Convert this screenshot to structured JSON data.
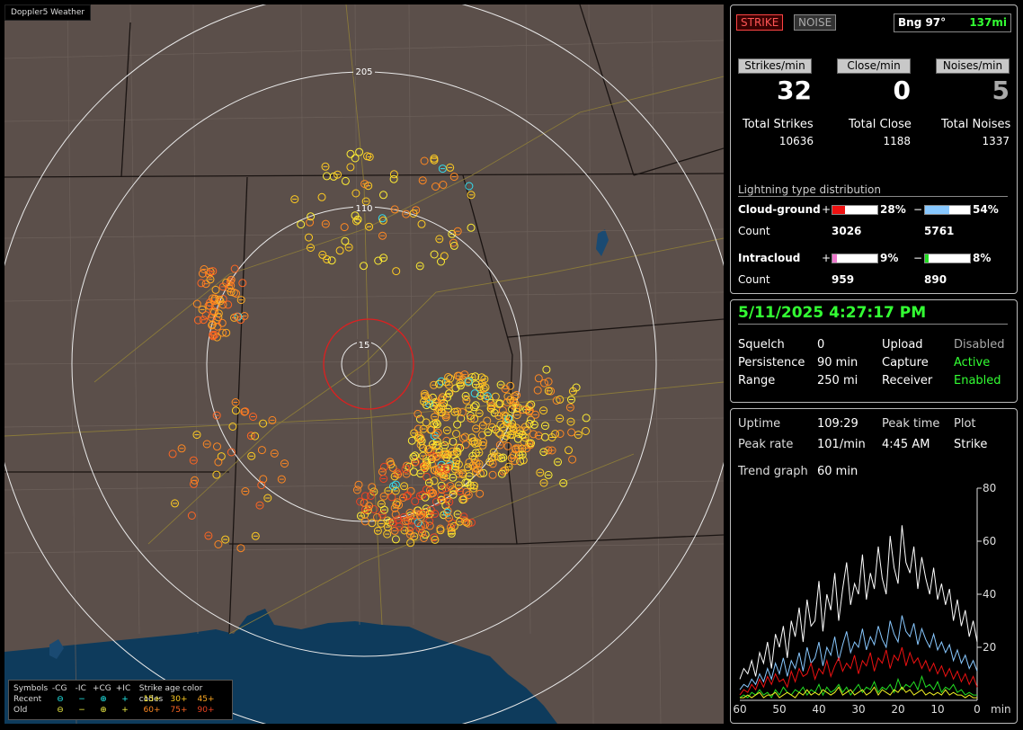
{
  "map": {
    "title": "Doppler5 Weather",
    "range_labels": [
      "205",
      "110",
      "15"
    ]
  },
  "legend": {
    "symbols_label": "Symbols",
    "cols": [
      "-CG",
      "-IC",
      "+CG",
      "+IC"
    ],
    "recent_label": "Recent",
    "old_label": "Old",
    "dash": "−",
    "plus": "+",
    "age_title": "Strike age color codes",
    "recent_ages": [
      "15+",
      "30+",
      "45+"
    ],
    "old_ages": [
      "60+",
      "75+",
      "90+"
    ]
  },
  "top": {
    "strike_btn": "STRIKE",
    "noise_btn": "NOISE",
    "bearing": "Bng 97°",
    "distance": "137mi"
  },
  "rates": {
    "strikes_label": "Strikes/min",
    "close_label": "Close/min",
    "noises_label": "Noises/min",
    "strikes_value": "32",
    "close_value": "0",
    "noises_value": "5"
  },
  "totals": {
    "strikes_label": "Total Strikes",
    "close_label": "Total Close",
    "noises_label": "Total Noises",
    "strikes_value": "10636",
    "close_value": "1188",
    "noises_value": "1337"
  },
  "distribution": {
    "title": "Lightning type distribution",
    "cg_label": "Cloud-ground",
    "ic_label": "Intracloud",
    "count_label": "Count",
    "plus": "+",
    "minus": "−",
    "cg_pos_pct": "28%",
    "cg_neg_pct": "54%",
    "ic_pos_pct": "9%",
    "ic_neg_pct": "8%",
    "cg_pos_frac": 0.28,
    "cg_neg_frac": 0.54,
    "ic_pos_frac": 0.09,
    "ic_neg_frac": 0.08,
    "cg_pos_count": "3026",
    "cg_neg_count": "5761",
    "ic_pos_count": "959",
    "ic_neg_count": "890",
    "colors": {
      "cg_pos": "#ee1111",
      "cg_neg": "#88c8ff",
      "ic_pos": "#ee77cc",
      "ic_neg": "#22dd22"
    }
  },
  "status": {
    "datetime": "5/11/2025 4:27:17 PM",
    "squelch_label": "Squelch",
    "squelch_value": "0",
    "persistence_label": "Persistence",
    "persistence_value": "90 min",
    "range_label": "Range",
    "range_value": "250 mi",
    "upload_label": "Upload",
    "upload_value": "Disabled",
    "capture_label": "Capture",
    "capture_value": "Active",
    "receiver_label": "Receiver",
    "receiver_value": "Enabled"
  },
  "stats": {
    "uptime_label": "Uptime",
    "uptime_value": "109:29",
    "peak_time_label": "Peak time",
    "peak_time_value": "4:45 AM",
    "plot_label": "Plot",
    "plot_value": "Strike",
    "peak_rate_label": "Peak rate",
    "peak_rate_value": "101/min",
    "trend_label": "Trend graph",
    "trend_value": "60 min"
  },
  "chart_data": {
    "type": "line",
    "xlabel": "min",
    "x_ticks": [
      "60",
      "50",
      "40",
      "30",
      "20",
      "10",
      "0"
    ],
    "y_ticks": [
      "80",
      "60",
      "40",
      "20"
    ],
    "xlim": [
      60,
      0
    ],
    "ylim": [
      0,
      80
    ],
    "series": [
      {
        "color": "#ffffff",
        "values": [
          8,
          12,
          10,
          15,
          9,
          18,
          14,
          22,
          12,
          25,
          20,
          28,
          16,
          30,
          24,
          35,
          22,
          38,
          28,
          30,
          45,
          26,
          40,
          34,
          48,
          30,
          42,
          52,
          36,
          44,
          40,
          55,
          38,
          48,
          42,
          58,
          46,
          40,
          62,
          50,
          44,
          66,
          52,
          48,
          58,
          42,
          54,
          46,
          40,
          50,
          38,
          44,
          36,
          42,
          30,
          38,
          28,
          34,
          24,
          30,
          22
        ]
      },
      {
        "color": "#88c8ff",
        "values": [
          4,
          6,
          5,
          8,
          6,
          10,
          7,
          12,
          8,
          14,
          10,
          16,
          9,
          15,
          12,
          18,
          11,
          20,
          14,
          16,
          22,
          13,
          20,
          17,
          24,
          15,
          21,
          26,
          18,
          22,
          20,
          27,
          19,
          24,
          21,
          28,
          23,
          20,
          30,
          25,
          22,
          32,
          26,
          24,
          29,
          21,
          27,
          23,
          20,
          25,
          19,
          22,
          18,
          21,
          15,
          19,
          14,
          17,
          12,
          15,
          11
        ]
      },
      {
        "color": "#ee1111",
        "values": [
          2,
          4,
          3,
          6,
          4,
          8,
          5,
          9,
          6,
          10,
          7,
          8,
          5,
          11,
          7,
          12,
          9,
          10,
          14,
          8,
          12,
          10,
          15,
          9,
          13,
          16,
          11,
          14,
          12,
          17,
          10,
          15,
          13,
          18,
          11,
          16,
          14,
          19,
          12,
          17,
          15,
          20,
          13,
          18,
          14,
          16,
          12,
          15,
          11,
          14,
          10,
          13,
          9,
          12,
          8,
          11,
          7,
          10,
          6,
          9,
          5
        ]
      },
      {
        "color": "#22dd22",
        "values": [
          1,
          2,
          1,
          3,
          2,
          4,
          2,
          3,
          1,
          4,
          2,
          5,
          3,
          2,
          4,
          3,
          5,
          2,
          4,
          3,
          6,
          2,
          5,
          3,
          4,
          6,
          3,
          5,
          2,
          4,
          6,
          3,
          5,
          4,
          7,
          3,
          5,
          4,
          6,
          3,
          8,
          4,
          6,
          5,
          7,
          4,
          9,
          5,
          6,
          4,
          7,
          3,
          5,
          4,
          6,
          3,
          4,
          2,
          3,
          2,
          2
        ]
      },
      {
        "color": "#eeee22",
        "values": [
          1,
          1,
          2,
          1,
          2,
          3,
          1,
          2,
          2,
          3,
          1,
          2,
          3,
          2,
          1,
          3,
          2,
          4,
          2,
          3,
          2,
          4,
          3,
          2,
          3,
          5,
          2,
          3,
          4,
          2,
          3,
          4,
          2,
          3,
          5,
          2,
          4,
          3,
          2,
          4,
          3,
          5,
          3,
          4,
          2,
          3,
          4,
          2,
          3,
          2,
          3,
          2,
          4,
          2,
          3,
          2,
          2,
          1,
          2,
          1,
          1
        ]
      }
    ]
  }
}
